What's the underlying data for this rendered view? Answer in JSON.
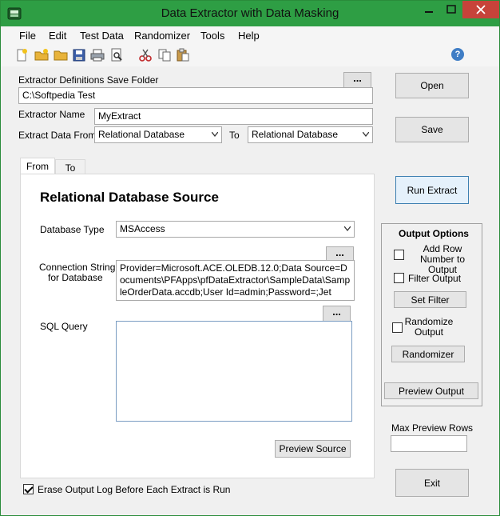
{
  "window": {
    "title": "Data Extractor with Data Masking"
  },
  "menu": [
    "File",
    "Edit",
    "Test Data",
    "Randomizer",
    "Tools",
    "Help"
  ],
  "toolbar": {
    "icons": [
      "new-file-icon",
      "open-folder-icon",
      "folder-icon",
      "save-icon",
      "print-icon",
      "print-preview-icon",
      "cut-icon",
      "copy-icon",
      "paste-icon",
      "help-icon"
    ],
    "help_glyph": "?"
  },
  "definitions": {
    "save_folder_label": "Extractor Definitions Save Folder",
    "save_folder_value": "C:\\Softpedia Test",
    "name_label": "Extractor Name",
    "name_value": "MyExtract",
    "extract_from_label": "Extract Data From",
    "extract_from_value": "Relational Database",
    "to_label": "To",
    "to_value": "Relational Database",
    "browse_label": "..."
  },
  "right_buttons": {
    "open": "Open",
    "save": "Save",
    "run_extract": "Run Extract",
    "exit": "Exit"
  },
  "tabs": [
    "From",
    "To"
  ],
  "source_panel": {
    "heading": "Relational Database Source",
    "db_type_label": "Database Type",
    "db_type_value": "MSAccess",
    "connection_label_line1": "Connection String",
    "connection_label_line2": "for Database",
    "connection_value": "Provider=Microsoft.ACE.OLEDB.12.0;Data Source=Documents\\PFApps\\pfDataExtractor\\SampleData\\SampleOrderData.accdb;User Id=admin;Password=;Jet",
    "sql_label": "SQL Query",
    "sql_value": "",
    "preview_source": "Preview Source"
  },
  "output_options": {
    "title": "Output Options",
    "add_row_number": "Add Row Number to Output",
    "filter_output": "Filter Output",
    "set_filter": "Set Filter",
    "randomize_output": "Randomize Output",
    "randomizer": "Randomizer",
    "preview_output": "Preview Output"
  },
  "max_preview": {
    "label": "Max Preview Rows",
    "value": ""
  },
  "erase_log": {
    "label": "Erase Output Log Before Each Extract is Run",
    "checked": true
  }
}
